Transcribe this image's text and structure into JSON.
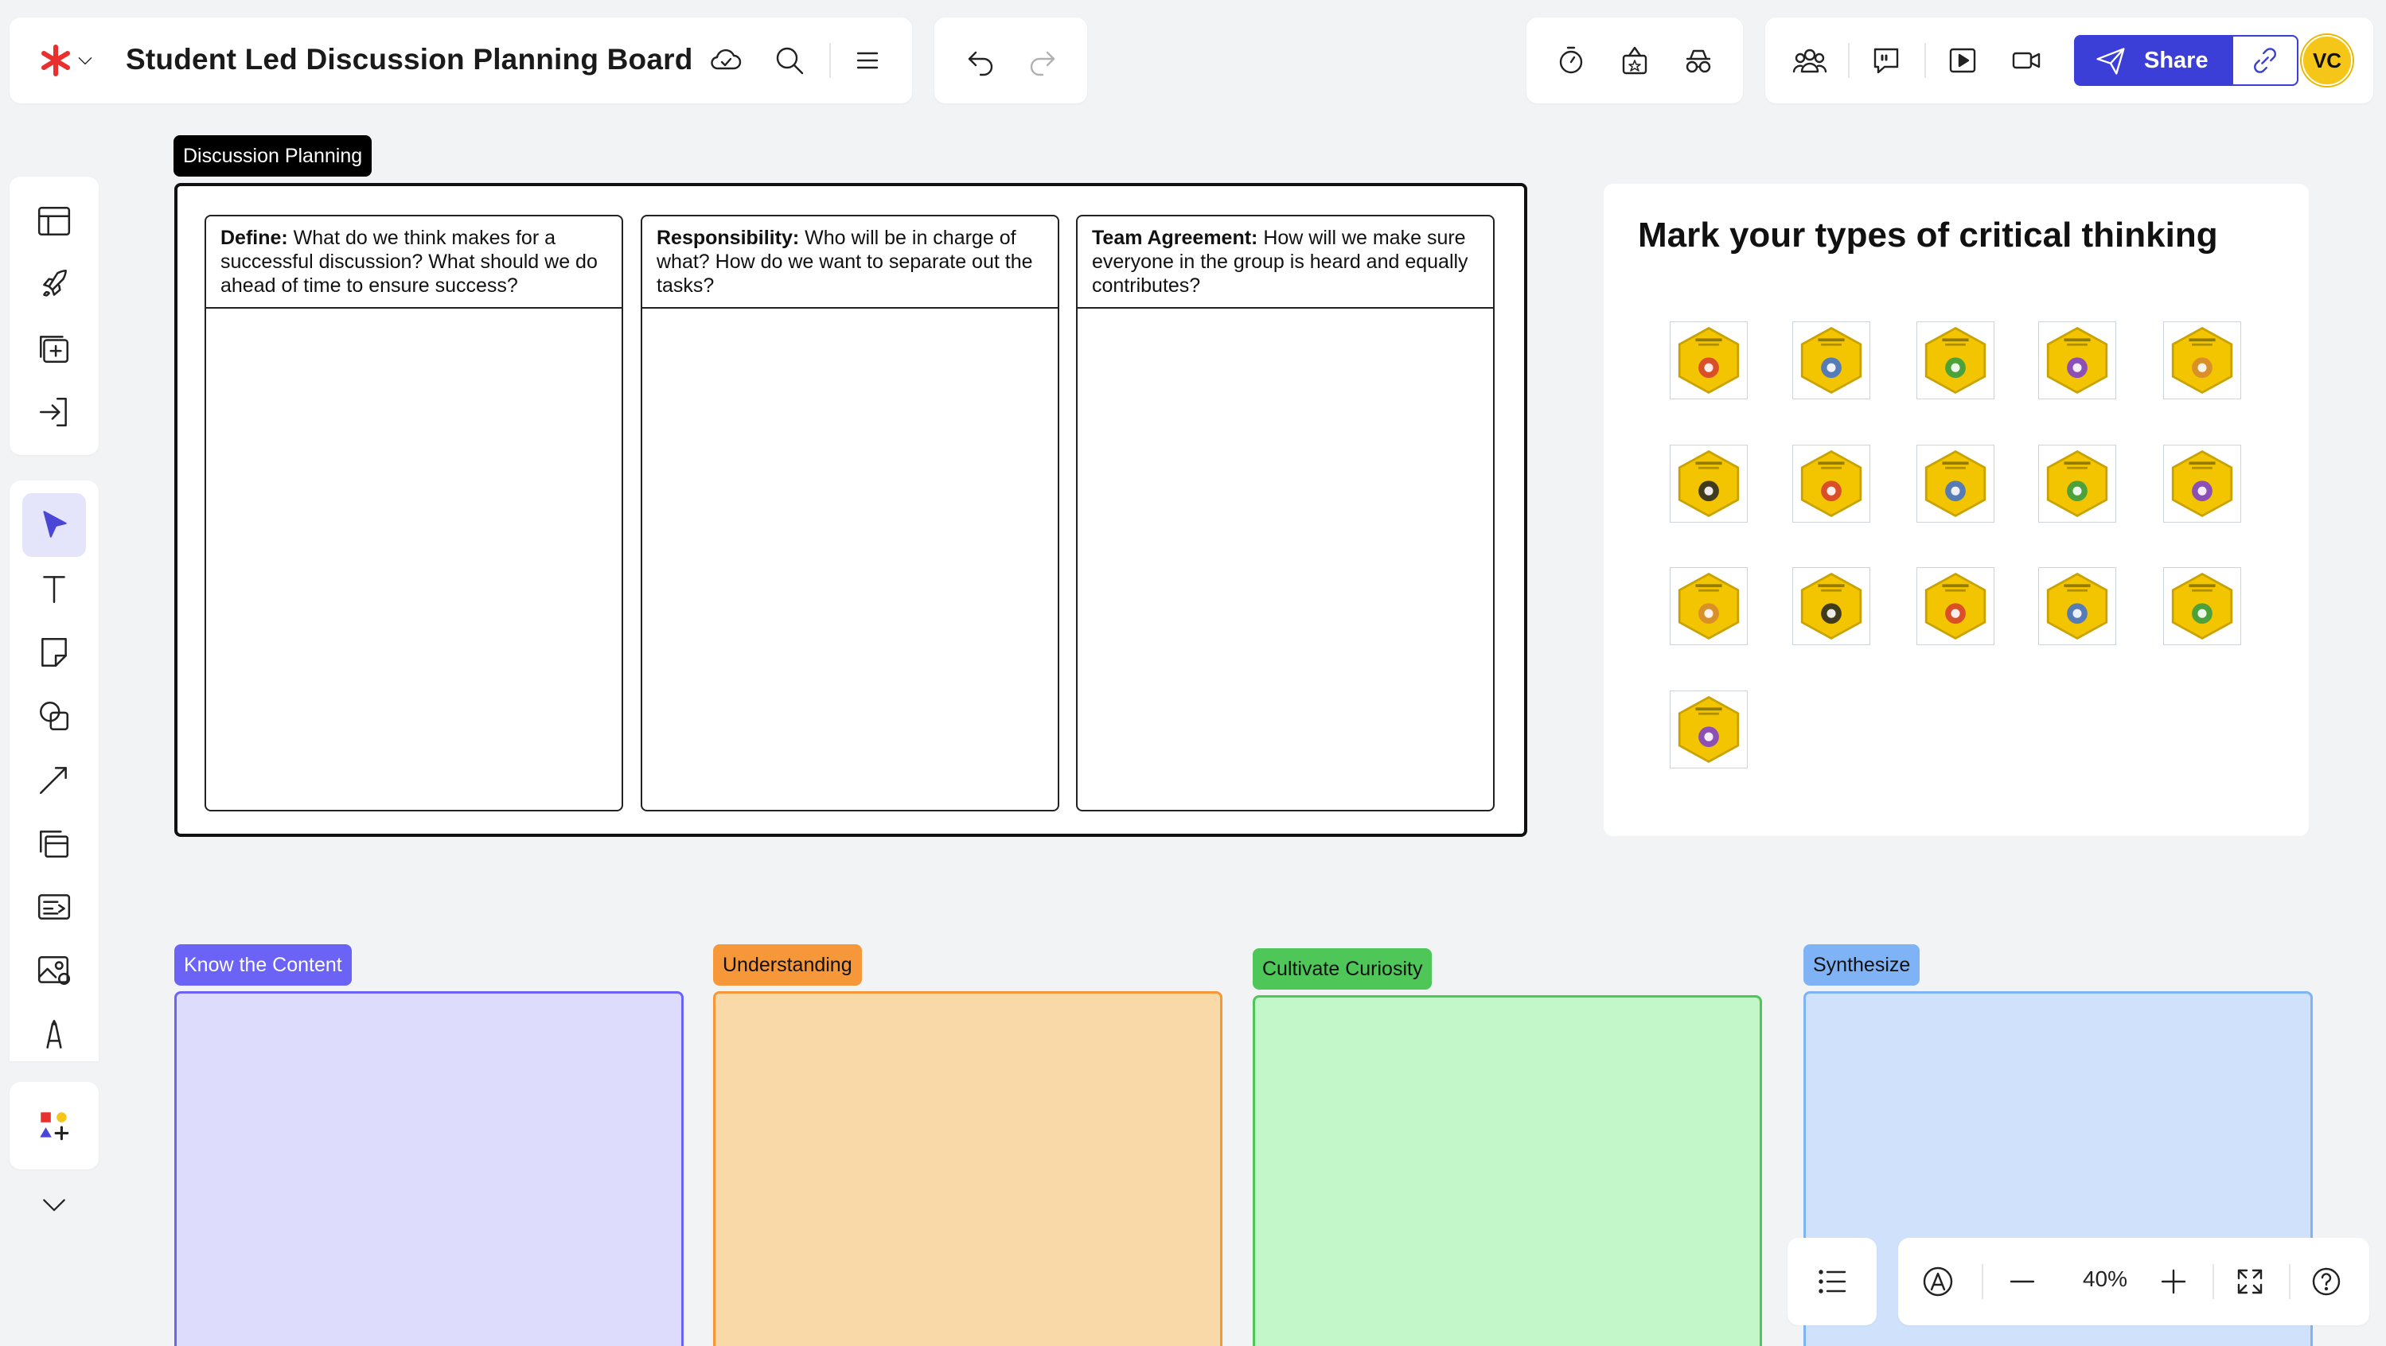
{
  "app": {
    "board_title": "Student Led Discussion Planning Board",
    "brand_color": "#e8312f"
  },
  "toolbar_left": {
    "icons": [
      "logo-asterisk-icon",
      "chevron-down-icon",
      "cloud-sync-icon",
      "search-icon",
      "menu-icon"
    ]
  },
  "history": {
    "icons": [
      "undo-icon",
      "redo-icon"
    ]
  },
  "toolbar_tools": {
    "icons": [
      "timer-icon",
      "voting-icon",
      "private-mode-icon"
    ]
  },
  "collab": {
    "icons": [
      "collaborators-icon",
      "comment-icon",
      "present-icon",
      "video-icon"
    ],
    "share_label": "Share",
    "share_color": "#3b3fd8",
    "avatar_initials": "VC",
    "avatar_color": "#f5c518"
  },
  "sidebar": {
    "top_icons": [
      "templates-icon",
      "rocket-icon",
      "add-board-icon",
      "import-icon"
    ],
    "tools": [
      "select-tool-icon",
      "text-tool-icon",
      "sticky-note-icon",
      "shapes-icon",
      "connector-icon",
      "frame-icon",
      "cards-icon",
      "image-icon",
      "pen-icon"
    ],
    "extras": [
      "apps-icon",
      "chevron-down-icon"
    ]
  },
  "discussion_planning": {
    "label": "Discussion Planning",
    "columns": [
      {
        "bold": "Define:",
        "text": " What do we think makes for a successful discussion?  What should we do ahead of time to ensure success?"
      },
      {
        "bold": "Responsibility:",
        "text": " Who will be in charge of what?  How do we want to separate out the tasks?"
      },
      {
        "bold": "Team Agreement:",
        "text": " How will we make sure everyone in the group is heard and equally contributes?"
      }
    ]
  },
  "critical_thinking": {
    "title": "Mark your types of critical thinking",
    "tile_color": "#f2c500",
    "tiles": [
      "evaluation-icon",
      "global-perspective-icon",
      "historical-perspective-icon",
      "interpersonal-communication-icon",
      "precision-icon",
      "problem-solving-icon",
      "questioning-icon",
      "self-discipline-icon",
      "self-reflection-icon",
      "cross-cultural-icon",
      "critical-thinking-icon",
      "creative-thinking-icon",
      "collaborative-inquiry-icon",
      "consideration-icon",
      "ethical-decision-icon",
      "fact-checking-icon"
    ]
  },
  "bottom_frames": [
    {
      "label": "Know the Content",
      "label_bg": "#6b63f6",
      "label_color": "#ffffff",
      "fill": "#dddcfd",
      "border": "#6b63f6"
    },
    {
      "label": "Understanding",
      "label_bg": "#f6983a",
      "label_color": "#111111",
      "fill": "#f9d9a8",
      "border": "#f6983a"
    },
    {
      "label": "Cultivate Curiosity",
      "label_bg": "#4ec758",
      "label_color": "#111111",
      "fill": "#c3f6c8",
      "border": "#4ec758"
    },
    {
      "label": "Synthesize",
      "label_bg": "#7fb3f5",
      "label_color": "#111111",
      "fill": "#cfe1fb",
      "border": "#7fb3f5"
    }
  ],
  "zoom": {
    "value": "40%",
    "icons": [
      "list-icon",
      "accessibility-icon",
      "zoom-out-icon",
      "zoom-in-icon",
      "fit-screen-icon",
      "help-icon"
    ]
  }
}
